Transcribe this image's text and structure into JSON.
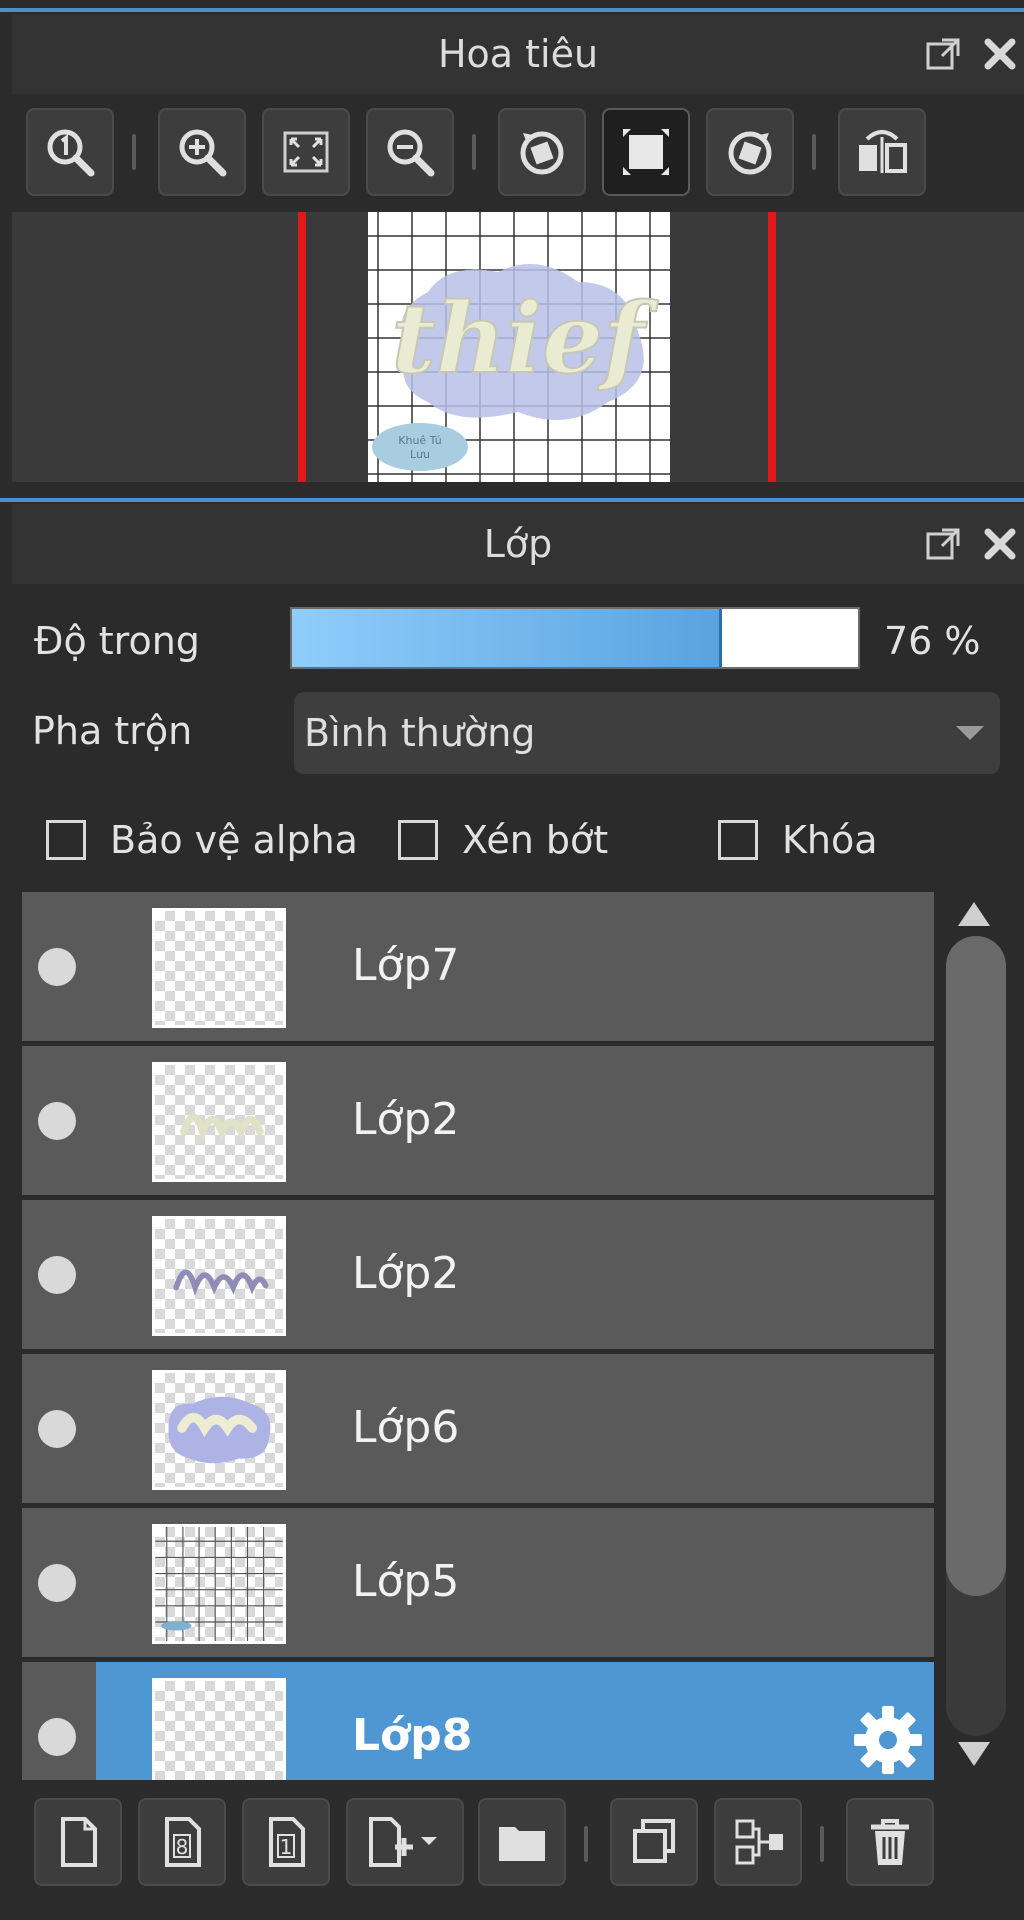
{
  "navigator": {
    "title": "Hoa tiêu",
    "toolbar": [
      "zoom-actual-icon",
      "zoom-in-icon",
      "fit-screen-icon",
      "zoom-out-icon",
      "rotate-left-icon",
      "fit-canvas-icon",
      "rotate-right-icon",
      "flip-horizontal-icon"
    ],
    "preview_thumbnail": {
      "word": "thief",
      "watermark_line1": "Khuê Tú",
      "watermark_line2": "Lưu"
    }
  },
  "layers_panel": {
    "title": "Lớp",
    "opacity": {
      "label": "Độ trong",
      "value": 76,
      "display": "76 %"
    },
    "blend": {
      "label": "Pha trộn",
      "value": "Bình thường"
    },
    "checkboxes": [
      {
        "label": "Bảo vệ alpha",
        "checked": false
      },
      {
        "label": "Xén bớt",
        "checked": false
      },
      {
        "label": "Khóa",
        "checked": false
      }
    ],
    "layers": [
      {
        "name": "Lớp7",
        "thumb": "blank",
        "selected": false
      },
      {
        "name": "Lớp2",
        "thumb": "text-cream",
        "selected": false
      },
      {
        "name": "Lớp2",
        "thumb": "text-purple",
        "selected": false
      },
      {
        "name": "Lớp6",
        "thumb": "blob",
        "selected": false
      },
      {
        "name": "Lớp5",
        "thumb": "grid",
        "selected": false
      },
      {
        "name": "Lớp8",
        "thumb": "blank",
        "selected": true
      }
    ],
    "bottom_toolbar": [
      "new-layer-icon",
      "new-8bit-layer-icon",
      "new-1bit-layer-icon",
      "add-layer-menu-icon",
      "folder-icon",
      "duplicate-layer-icon",
      "merge-down-icon",
      "delete-layer-icon"
    ]
  },
  "colors": {
    "accent": "#4f97d2",
    "panel_topline": "#4a8fcf",
    "view_frame": "#e01818"
  }
}
